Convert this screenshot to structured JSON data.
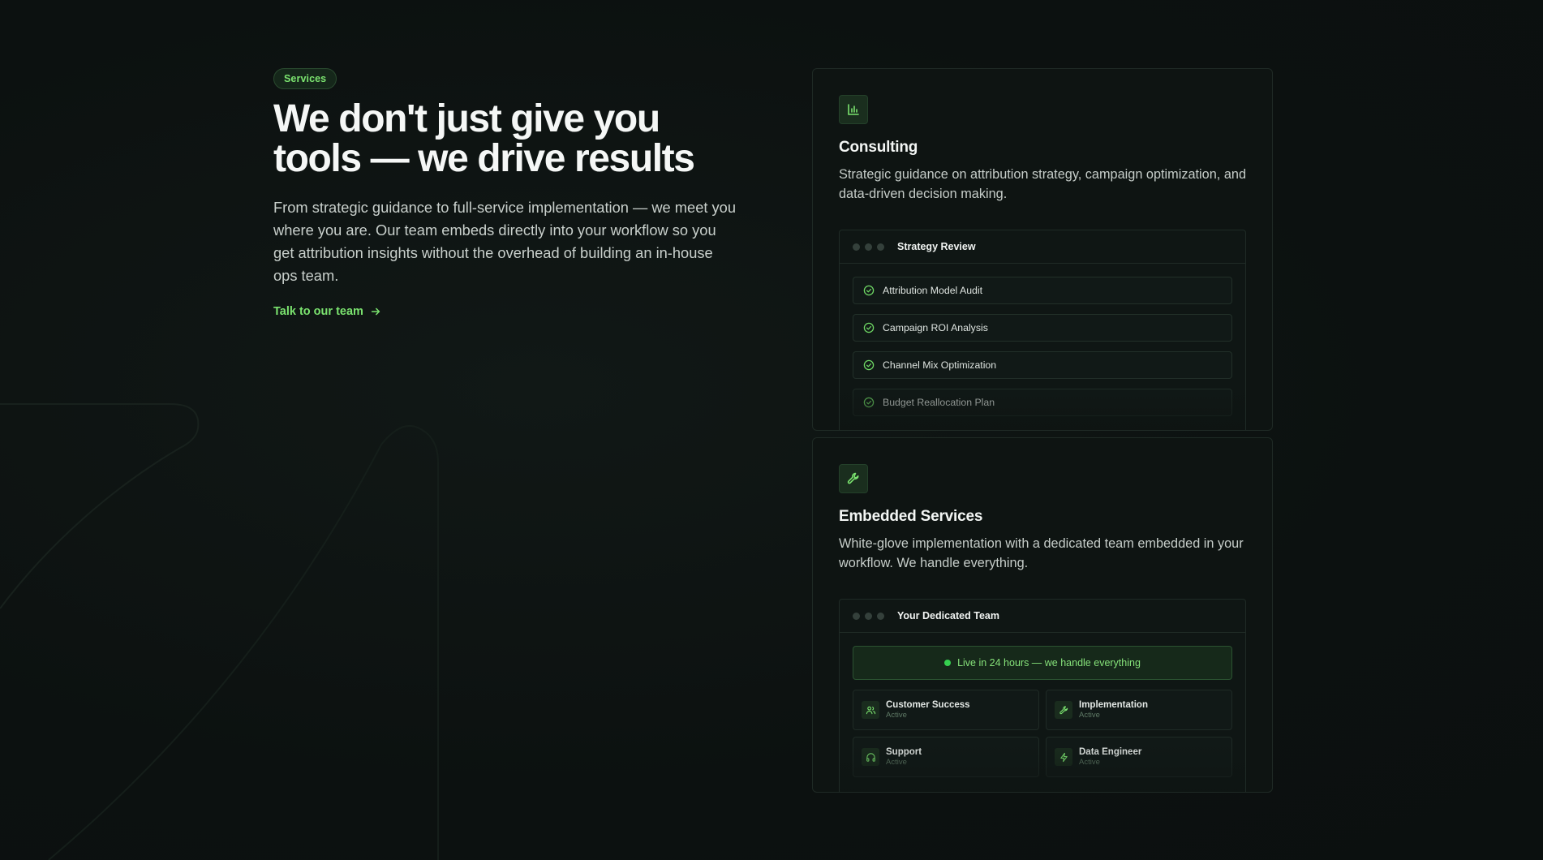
{
  "section": {
    "badge": "Services",
    "headline": "We don't just give you tools — we drive results",
    "description": "From strategic guidance to full-service implementation — we meet you where you are. Our team embeds directly into your workflow so you get attribution insights without the overhead of building an in-house ops team.",
    "cta_label": "Talk to our team"
  },
  "consulting": {
    "icon": "bar-chart-icon",
    "title": "Consulting",
    "description": "Strategic guidance on attribution strategy, campaign optimization, and data-driven decision making.",
    "panel_title": "Strategy Review",
    "tasks": [
      {
        "label": "Attribution Model Audit",
        "done": true
      },
      {
        "label": "Campaign ROI Analysis",
        "done": true
      },
      {
        "label": "Channel Mix Optimization",
        "done": false
      },
      {
        "label": "Budget Reallocation Plan",
        "done": false
      }
    ]
  },
  "embedded": {
    "icon": "wrench-icon",
    "title": "Embedded Services",
    "description": "White-glove implementation with a dedicated team embedded in your workflow. We handle everything.",
    "panel_title": "Your Dedicated Team",
    "live_banner": "Live in 24 hours — we handle everything",
    "members": [
      {
        "name": "Customer Success",
        "status": "Active",
        "icon": "users-icon"
      },
      {
        "name": "Implementation",
        "status": "Active",
        "icon": "wrench-icon"
      },
      {
        "name": "Support",
        "status": "Active",
        "icon": "headphones-icon"
      },
      {
        "name": "Data Engineer",
        "status": "Active",
        "icon": "lightning-icon"
      }
    ]
  },
  "colors": {
    "accent": "#7be36f",
    "background": "#0c1110",
    "card_border": "#1f2a25",
    "live_dot": "#35d04f"
  }
}
